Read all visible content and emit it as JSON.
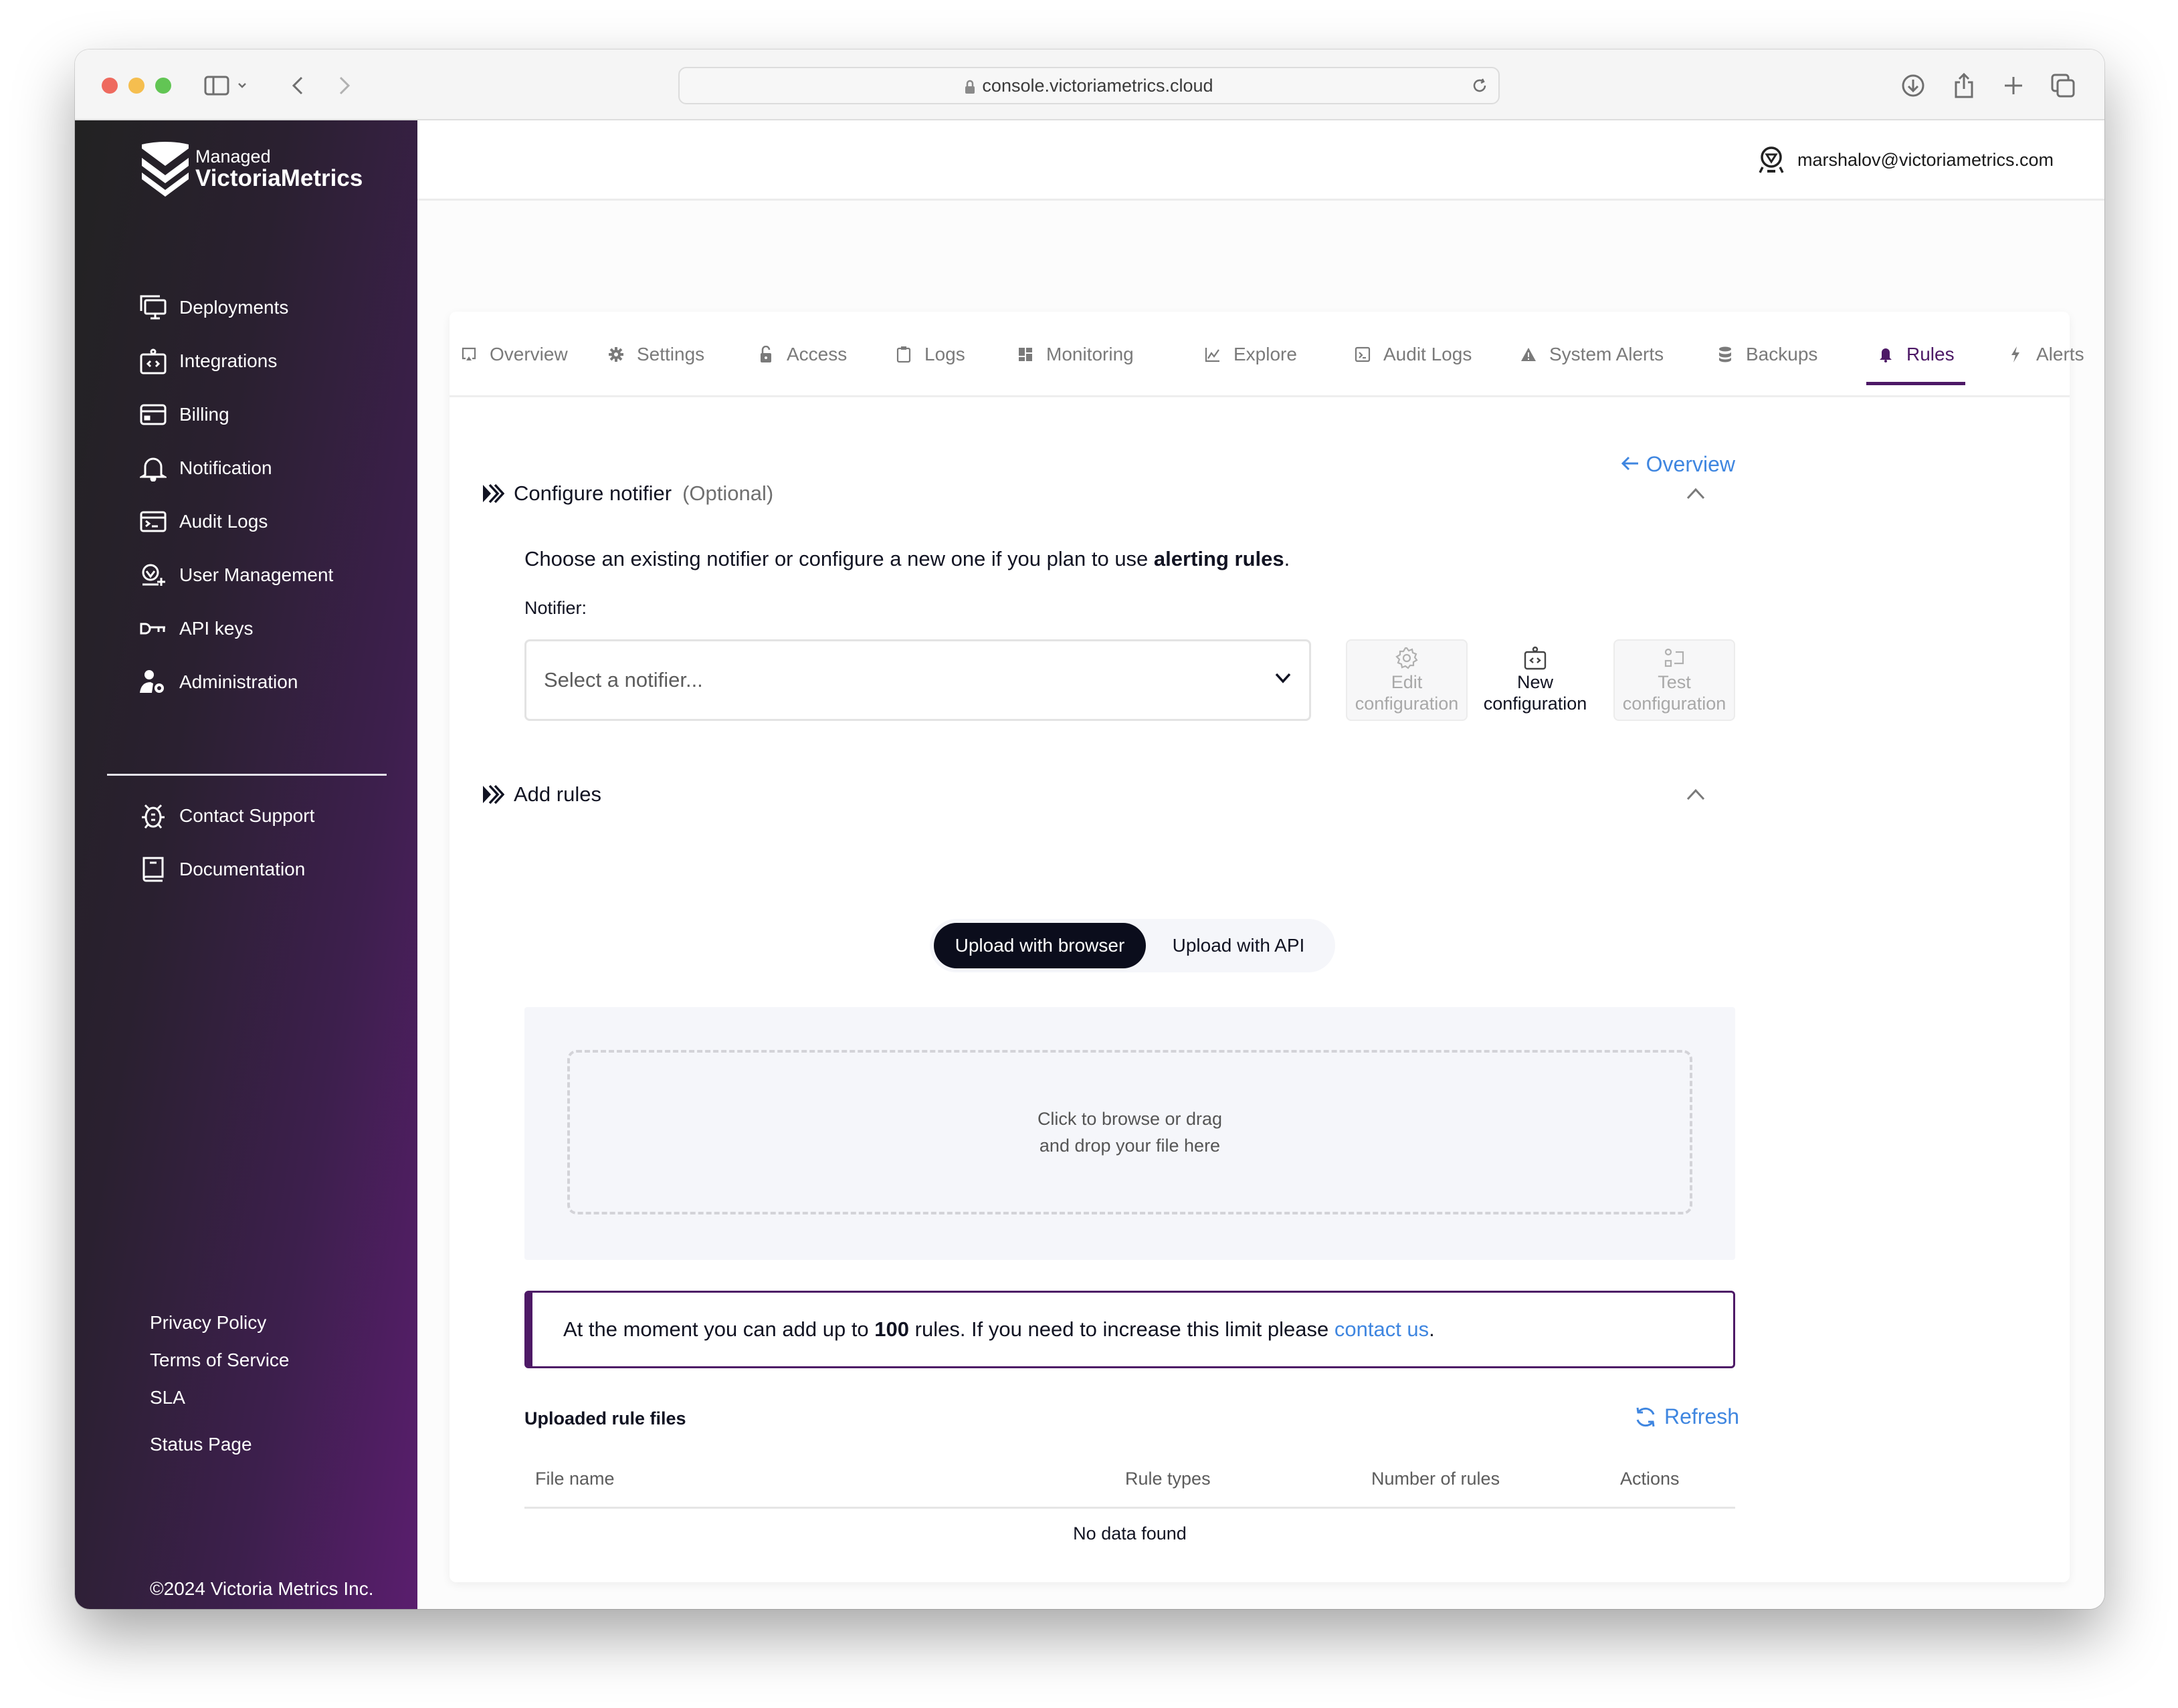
{
  "browser": {
    "url": "console.victoriametrics.cloud",
    "icons": [
      "sidebar-toggle-icon",
      "chevron-down-icon",
      "back-icon",
      "forward-icon",
      "lock-icon",
      "reload-icon",
      "download-icon",
      "share-icon",
      "new-tab-icon",
      "tabs-overview-icon"
    ]
  },
  "sidebar": {
    "logo": {
      "managed": "Managed",
      "brand": "VictoriaMetrics"
    },
    "items": [
      {
        "label": "Deployments",
        "icon": "monitor-icon"
      },
      {
        "label": "Integrations",
        "icon": "integration-icon"
      },
      {
        "label": "Billing",
        "icon": "credit-card-icon"
      },
      {
        "label": "Notification",
        "icon": "bell-icon"
      },
      {
        "label": "Audit Logs",
        "icon": "terminal-icon"
      },
      {
        "label": "User Management",
        "icon": "user-add-icon"
      },
      {
        "label": "API keys",
        "icon": "key-icon"
      },
      {
        "label": "Administration",
        "icon": "user-gear-icon"
      }
    ],
    "secondary": [
      {
        "label": "Contact Support",
        "icon": "bug-icon"
      },
      {
        "label": "Documentation",
        "icon": "book-icon"
      }
    ],
    "footer_links": [
      "Privacy Policy",
      "Terms of Service",
      "SLA",
      "Status Page"
    ],
    "copyright": "©2024 Victoria Metrics Inc."
  },
  "header": {
    "user_email": "marshalov@victoriametrics.com"
  },
  "tabs": [
    {
      "label": "Overview",
      "icon": "monitor-icon",
      "active": false
    },
    {
      "label": "Settings",
      "icon": "gear-icon",
      "active": false
    },
    {
      "label": "Access",
      "icon": "lock-icon",
      "active": false
    },
    {
      "label": "Logs",
      "icon": "clipboard-icon",
      "active": false
    },
    {
      "label": "Monitoring",
      "icon": "dashboard-icon",
      "active": false
    },
    {
      "label": "Explore",
      "icon": "chart-line-icon",
      "active": false
    },
    {
      "label": "Audit Logs",
      "icon": "terminal-icon",
      "active": false
    },
    {
      "label": "System Alerts",
      "icon": "warning-icon",
      "active": false
    },
    {
      "label": "Backups",
      "icon": "database-icon",
      "active": false
    },
    {
      "label": "Rules",
      "icon": "bell-icon",
      "active": true
    },
    {
      "label": "Alerts",
      "icon": "lightning-icon",
      "active": false
    }
  ],
  "colors": {
    "accent": "#4d1966",
    "link": "#3f86e0",
    "dark": "#0b0d1c"
  },
  "content": {
    "back_link": "Overview",
    "notifier_section": {
      "title": "Configure notifier",
      "optional": "(Optional)",
      "intro_prefix": "Choose an existing notifier or configure a new one if you plan to use ",
      "intro_bold": "alerting rules",
      "intro_suffix": ".",
      "label": "Notifier:",
      "select_placeholder": "Select a notifier...",
      "buttons": [
        {
          "line1": "Edit",
          "line2": "configuration",
          "enabled": false
        },
        {
          "line1": "New",
          "line2": "configuration",
          "enabled": true
        },
        {
          "line1": "Test",
          "line2": "configuration",
          "enabled": false
        }
      ]
    },
    "rules_section": {
      "title": "Add rules",
      "upload_options": [
        {
          "label": "Upload with browser",
          "active": true
        },
        {
          "label": "Upload with API",
          "active": false
        }
      ],
      "dropzone_line1": "Click to browse or drag",
      "dropzone_line2": "and drop your file here",
      "notice_prefix": "At the moment you can add up to ",
      "notice_limit": "100",
      "notice_middle": " rules. If you need to increase this limit please ",
      "notice_link": "contact us",
      "notice_suffix": "."
    },
    "files": {
      "title": "Uploaded rule files",
      "refresh": "Refresh",
      "columns": [
        "File name",
        "Rule types",
        "Number of rules",
        "Actions"
      ],
      "rows": [],
      "empty_text": "No data found"
    }
  }
}
